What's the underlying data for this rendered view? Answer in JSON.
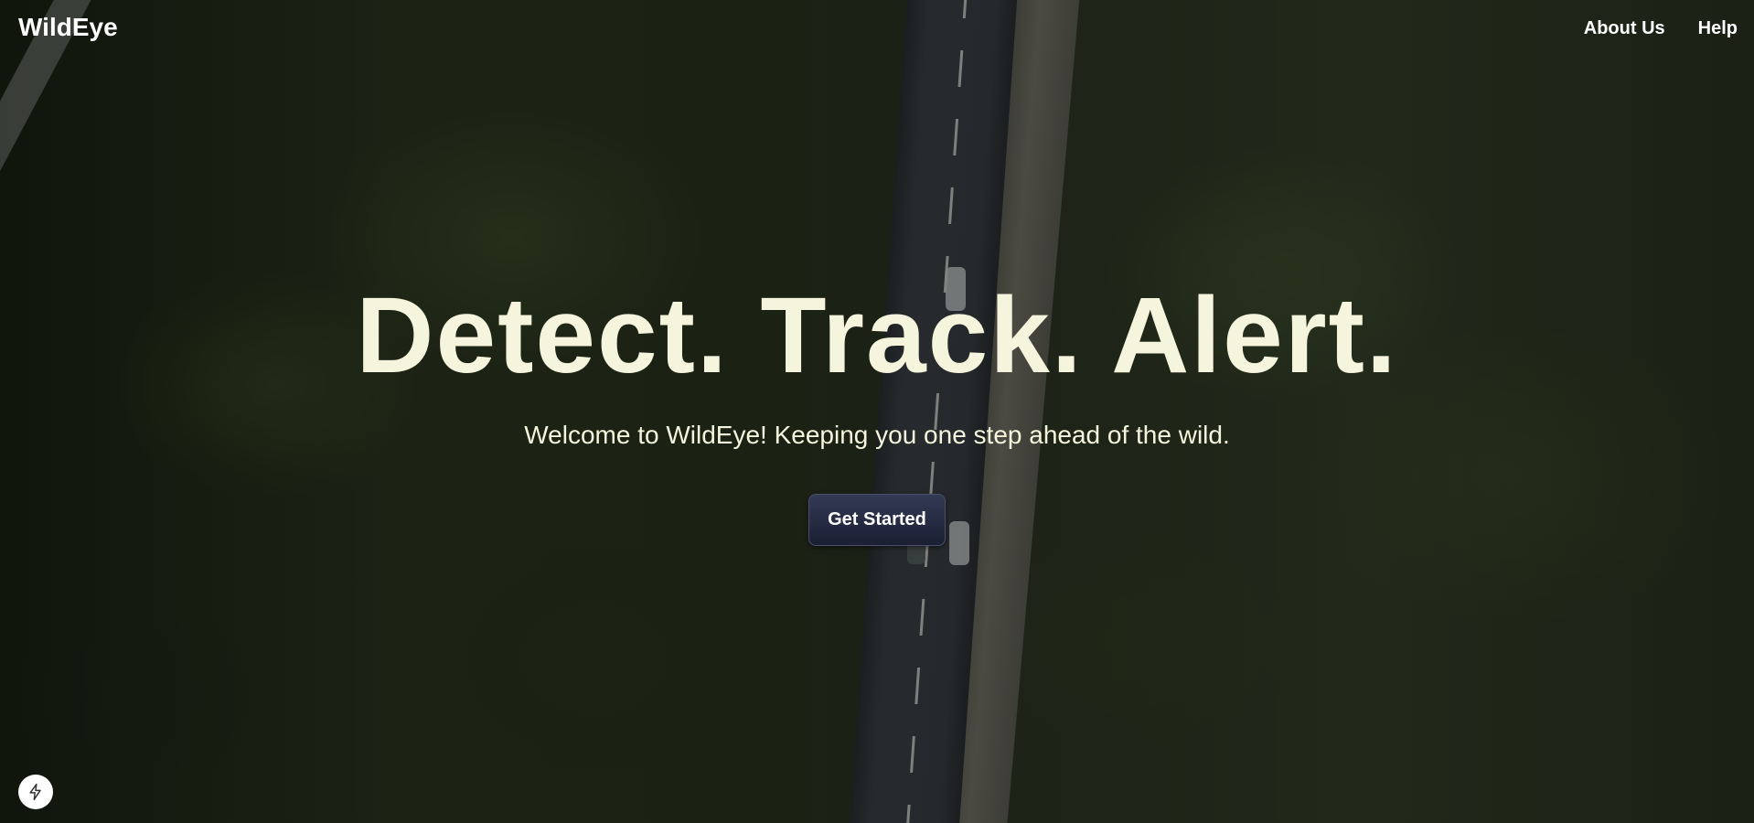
{
  "nav": {
    "brand": "WildEye",
    "links": [
      {
        "label": "About Us"
      },
      {
        "label": "Help"
      }
    ]
  },
  "hero": {
    "title": "Detect. Track. Alert.",
    "subtitle": "Welcome to WildEye! Keeping you one step ahead of the wild.",
    "cta_label": "Get Started"
  },
  "colors": {
    "hero_text": "#f5f4dc",
    "nav_text": "#ffffff",
    "button_bg": "#1b1f33"
  },
  "icons": {
    "badge": "lightning-bolt-icon"
  }
}
